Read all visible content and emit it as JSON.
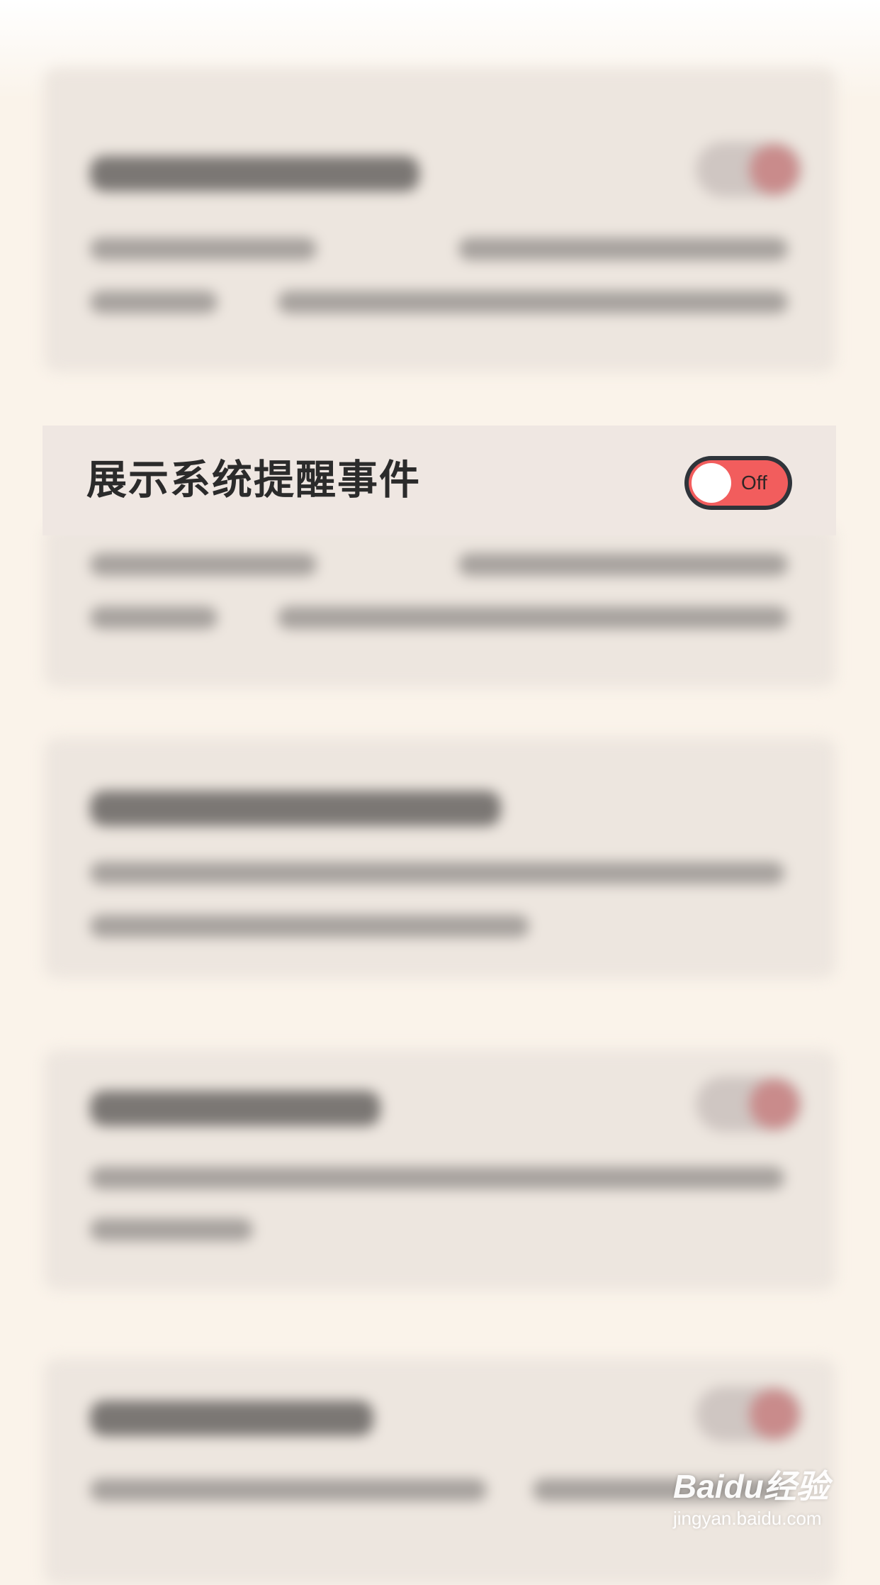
{
  "setting": {
    "label": "展示系统提醒事件",
    "toggle_state": "Off",
    "enabled": false,
    "track_color": "#f25d5d",
    "border_color": "#2f343a"
  },
  "watermark": {
    "logo": "Baidu经验",
    "url": "jingyan.baidu.com"
  }
}
